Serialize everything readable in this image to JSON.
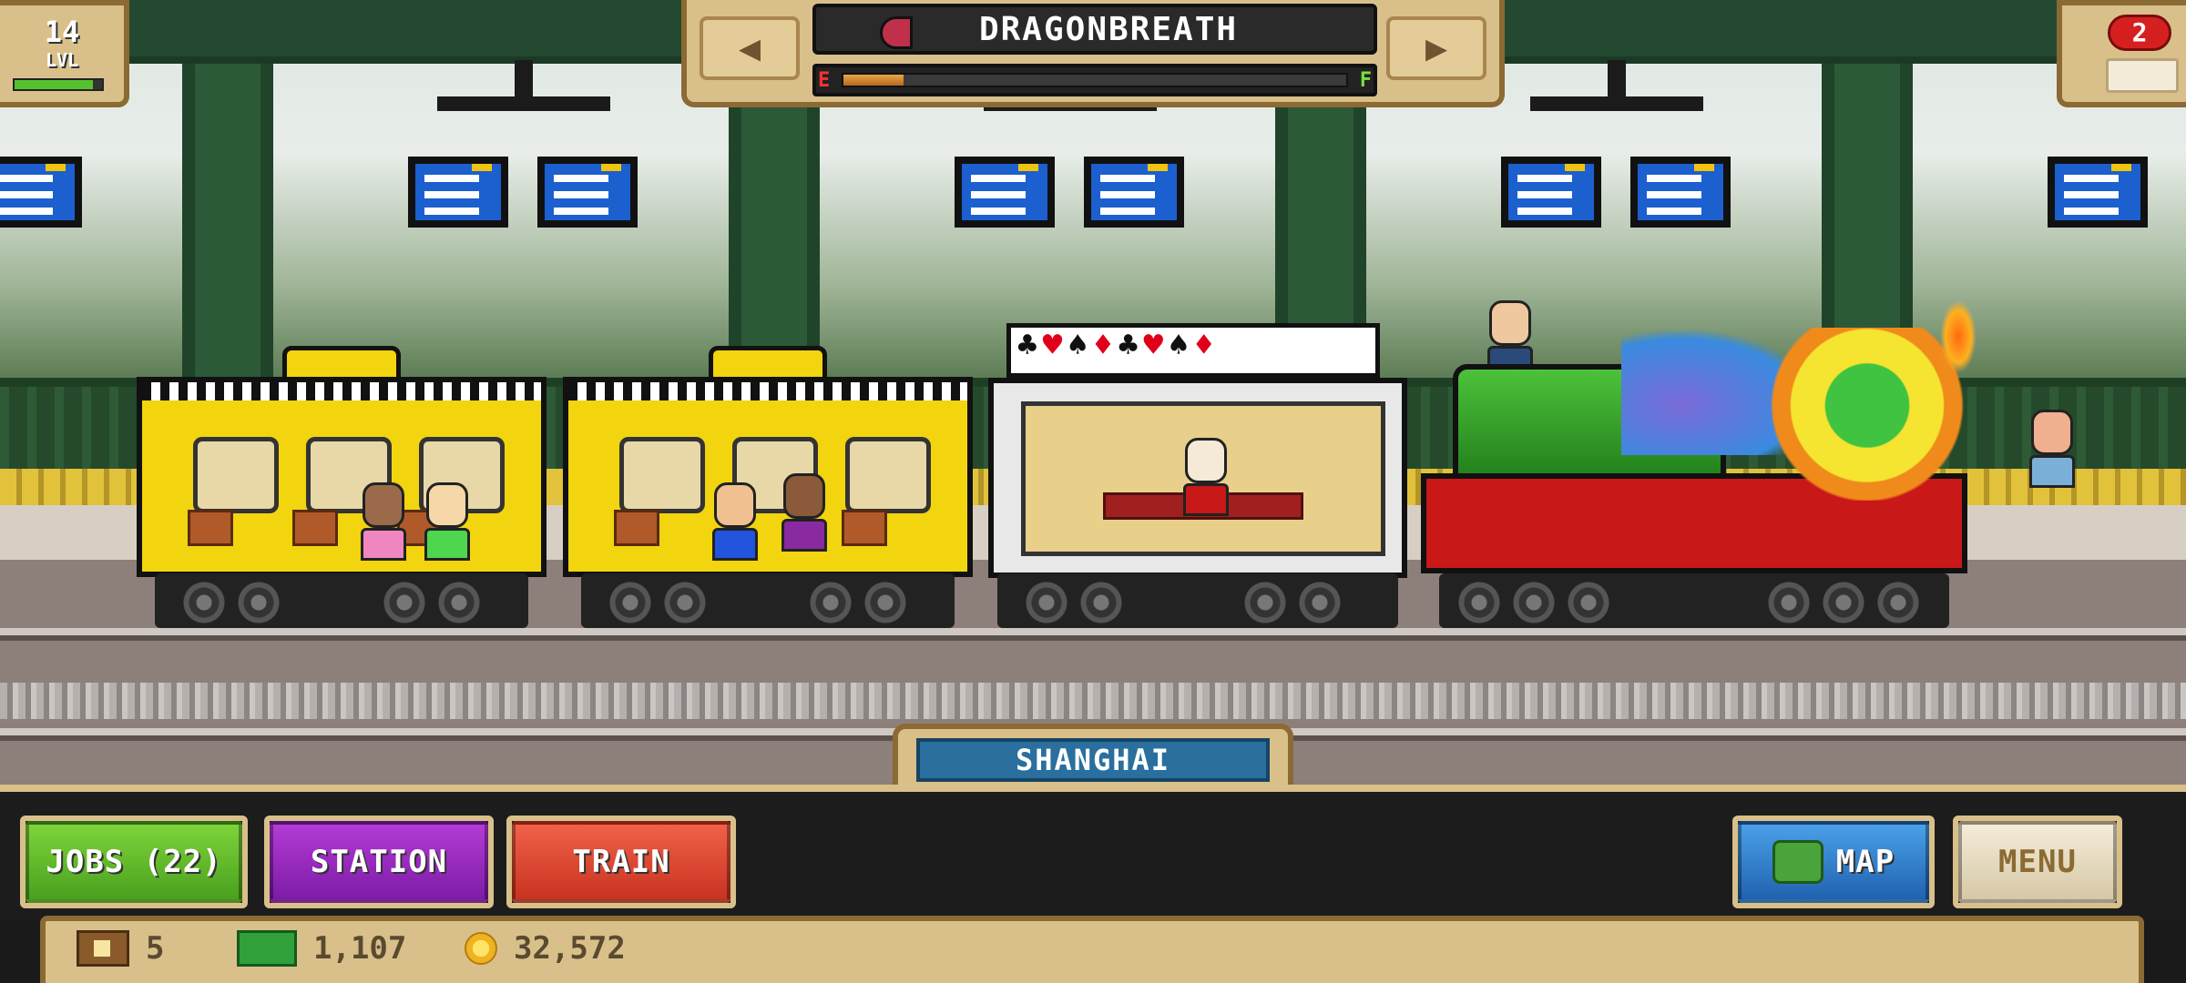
{
  "level": {
    "number": "14",
    "label": "LVL",
    "progress": 0.9
  },
  "train_selector": {
    "name": "DRAGONBREATH",
    "prev_label": "◀",
    "next_label": "▶",
    "fuel_empty_label": "E",
    "fuel_full_label": "F",
    "fuel_level": 0.12
  },
  "trains_count": "2",
  "station": {
    "name": "SHANGHAI"
  },
  "cards_row": [
    "♣",
    "♥",
    "♠",
    "♦",
    "♣",
    "♥",
    "♠",
    "♦"
  ],
  "buttons": {
    "jobs": "JOBS (22)",
    "station": "STATION",
    "train": "TRAIN",
    "map": "MAP",
    "menu": "MENU"
  },
  "resources": {
    "tickets": "5",
    "cash": "1,107",
    "coins": "32,572"
  },
  "colors": {
    "jobs_green": "#4aa01e",
    "station_purple": "#7d1ca6",
    "train_red": "#c8331f",
    "map_blue": "#2062b0",
    "hud_gold": "#d9c08a"
  }
}
